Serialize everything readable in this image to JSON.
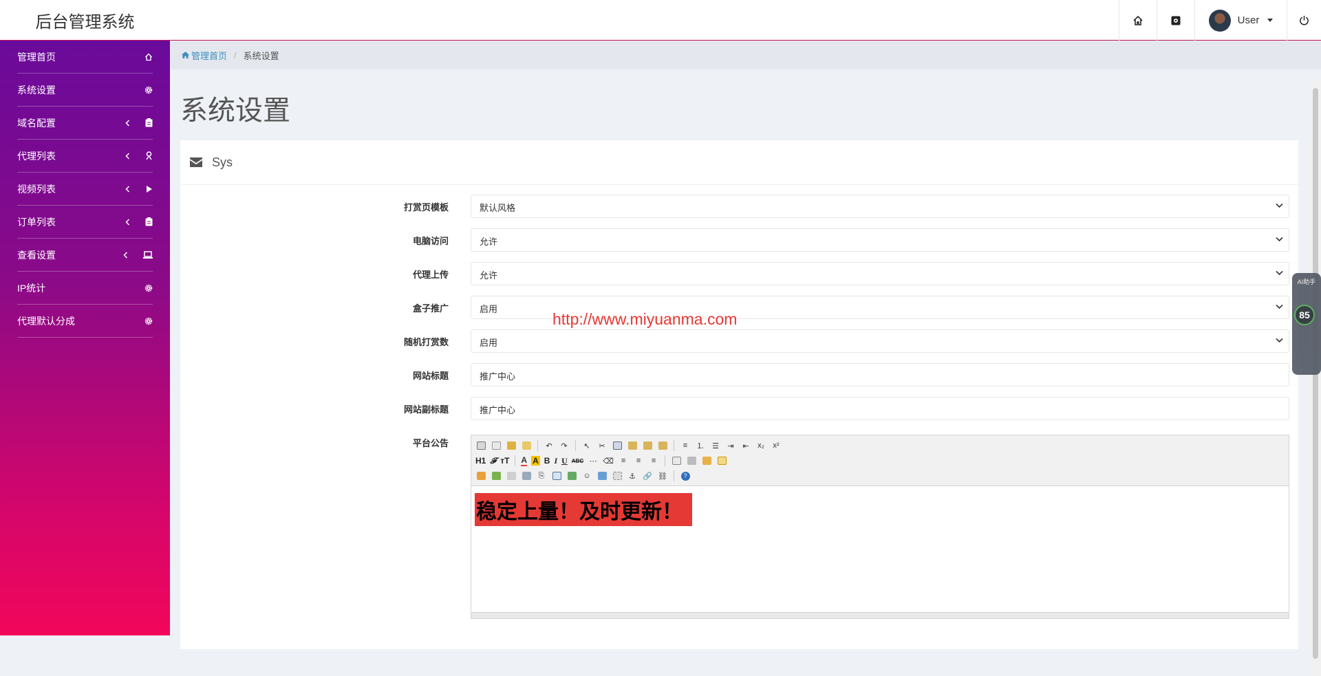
{
  "brand": {
    "title": "后台管理系统"
  },
  "topnav": {
    "user_label": "User"
  },
  "sidebar": {
    "items": [
      {
        "label": "管理首页",
        "icon": "home-icon"
      },
      {
        "label": "系统设置",
        "icon": "gear-icon"
      },
      {
        "label": "域名配置",
        "icon": "clipboard-icon"
      },
      {
        "label": "代理列表",
        "icon": "person-icon"
      },
      {
        "label": "视频列表",
        "icon": "play-icon"
      },
      {
        "label": "订单列表",
        "icon": "clipboard-icon"
      },
      {
        "label": "查看设置",
        "icon": "laptop-icon"
      },
      {
        "label": "IP统计",
        "icon": "gear-icon"
      },
      {
        "label": "代理默认分成",
        "icon": "gear-icon"
      }
    ]
  },
  "breadcrumb": {
    "home": "管理首页",
    "current": "系统设置"
  },
  "page": {
    "title": "系统设置"
  },
  "panel": {
    "title": "Sys"
  },
  "form": {
    "fields": [
      {
        "label": "打赏页模板",
        "value": "默认风格"
      },
      {
        "label": "电脑访问",
        "value": "允许"
      },
      {
        "label": "代理上传",
        "value": "允许"
      },
      {
        "label": "盒子推广",
        "value": "启用"
      },
      {
        "label": "随机打赏数",
        "value": "启用"
      },
      {
        "label": "网站标题",
        "value": "推广中心"
      },
      {
        "label": "网站副标题",
        "value": "推广中心"
      }
    ],
    "notice_label": "平台公告",
    "notice_text": "稳定上量！及时更新！"
  },
  "editor_toolbar": {
    "h1": "H1",
    "font": "𝒩",
    "size": "тT",
    "bold": "B",
    "italic": "I",
    "underline": "U",
    "abc": "ABC"
  },
  "watermark": "http://www.miyuanma.com",
  "float_tools": {
    "score": "85",
    "ai_label": "AI助手"
  },
  "colors": {
    "sidebar_top": "#6a0a9a",
    "sidebar_bottom": "#f2065a",
    "link": "#3c8dbc",
    "notice_bg": "#e53935"
  }
}
